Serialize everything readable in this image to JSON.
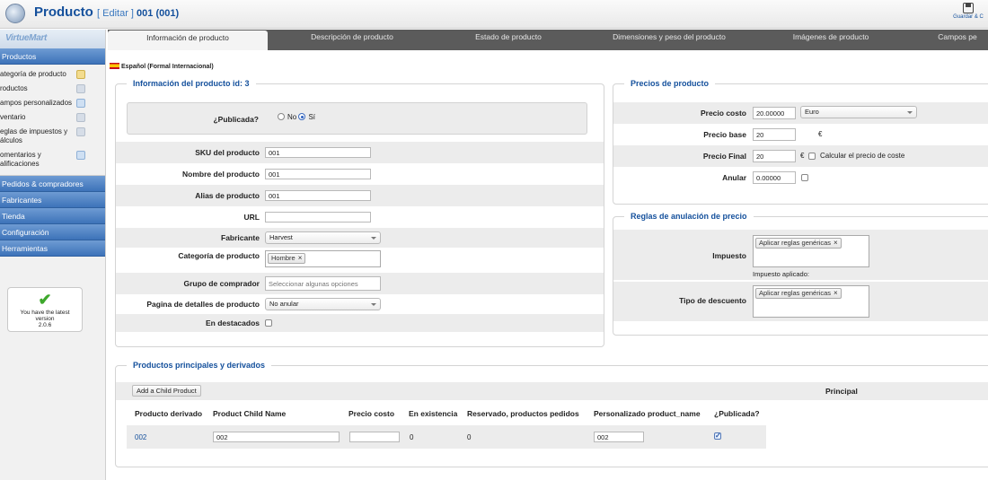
{
  "header": {
    "title": "Producto",
    "edit_label": "[ Editar ]",
    "record": "001 (001)",
    "save_label": "Guardar & C"
  },
  "sidebar": {
    "brand_a": "Virtue",
    "brand_b": "Mart",
    "section_products": "Productos",
    "items": [
      {
        "label": "ategoría de producto",
        "icon": "folder-icon"
      },
      {
        "label": "roductos",
        "icon": "list-icon"
      },
      {
        "label": "ampos personalizados",
        "icon": "custom-fields-icon"
      },
      {
        "label": "ventario",
        "icon": "inventory-icon"
      },
      {
        "label": "eglas de impuestos y álculos",
        "icon": "tax-icon"
      },
      {
        "label": "omentarios y alificaciones",
        "icon": "reviews-icon"
      }
    ],
    "sections": [
      "Pedidos & compradores",
      "Fabricantes",
      "Tienda",
      "Configuración",
      "Herramientas"
    ],
    "version_line1": "You have the latest",
    "version_line2": "version",
    "version_number": "2.0.6"
  },
  "tabs": [
    "Información de producto",
    "Descripción de producto",
    "Estado de producto",
    "Dimensiones y peso del producto",
    "Imágenes de producto",
    "Campos pe"
  ],
  "language_label": "Español (Formal Internacional)",
  "info": {
    "legend": "Información del producto id: 3",
    "published_label": "¿Publicada?",
    "opt_no": "No",
    "opt_yes": "Sí",
    "sku_label": "SKU del producto",
    "sku_value": "001",
    "name_label": "Nombre del producto",
    "name_value": "001",
    "alias_label": "Alias de producto",
    "alias_value": "001",
    "url_label": "URL",
    "url_value": "",
    "manufacturer_label": "Fabricante",
    "manufacturer_value": "Harvest",
    "category_label": "Categoría de producto",
    "category_tag": "Hombre",
    "shopper_group_label": "Grupo de comprador",
    "shopper_group_placeholder": "Seleccionar algunas opciones",
    "detail_page_label": "Pagina de detalles de producto",
    "detail_page_value": "No anular",
    "featured_label": "En destacados"
  },
  "prices": {
    "legend": "Precios de producto",
    "cost_label": "Precio costo",
    "cost_value": "20.00000",
    "currency": "Euro",
    "base_label": "Precio base",
    "base_value": "20",
    "euro_symbol": "€",
    "final_label": "Precio Final",
    "final_value": "20",
    "calc_cost_label": "Calcular el precio de coste",
    "override_label": "Anular",
    "override_value": "0.00000"
  },
  "rules": {
    "legend": "Reglas de anulación de precio",
    "tax_label": "Impuesto",
    "tax_tag": "Aplicar reglas genéricas",
    "tax_applied": "Impuesto aplicado:",
    "discount_label": "Tipo de descuento",
    "discount_tag": "Aplicar reglas genéricas"
  },
  "children": {
    "legend": "Productos principales y derivados",
    "add_button": "Add a Child Product",
    "principal_label": "Principal",
    "headers": [
      "Producto derivado",
      "Product Child Name",
      "Precio costo",
      "En existencia",
      "Reservado, productos pedidos",
      "Personalizado product_name",
      "¿Publicada?"
    ],
    "row": {
      "child_id": "002",
      "child_name": "002",
      "cost": "",
      "stock": "0",
      "reserved": "0",
      "custom_name": "002"
    }
  }
}
